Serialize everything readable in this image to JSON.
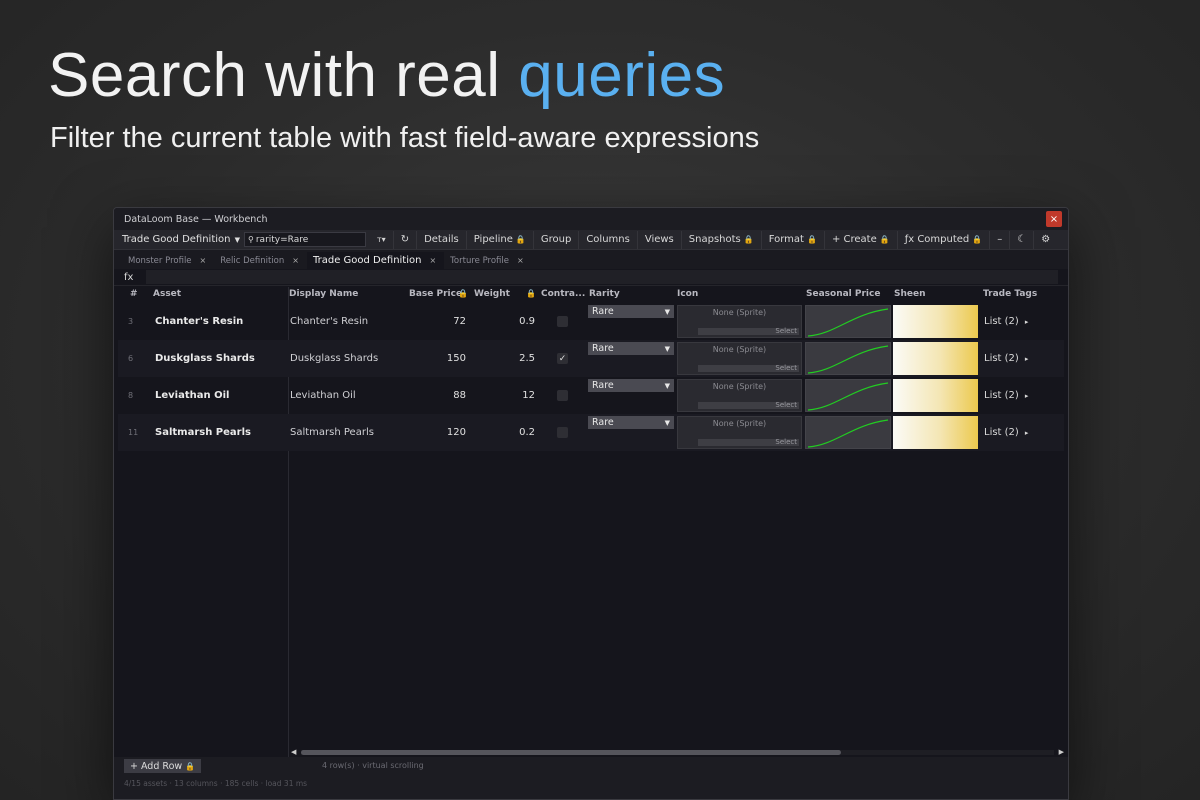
{
  "hero": {
    "title_main": "Search with real ",
    "title_accent": "queries",
    "subtitle": "Filter the current table with fast field-aware expressions"
  },
  "window": {
    "title": "DataLoom Base — Workbench",
    "close": "×"
  },
  "toolbar": {
    "table_select": "Trade Good Definition",
    "search_value": "rarity=Rare",
    "search_icon": "⚲",
    "filter_label": "ᴛ▾",
    "refresh_icon": "↻",
    "buttons": [
      "Details",
      "Pipeline",
      "Group",
      "Columns",
      "Views",
      "Snapshots",
      "Format",
      "+ Create",
      "ƒx Computed",
      "–",
      "☾",
      "⚙"
    ],
    "locked": [
      false,
      true,
      false,
      false,
      false,
      true,
      true,
      true,
      true,
      false,
      false,
      false
    ]
  },
  "tabs": [
    {
      "label": "Monster Profile",
      "active": false
    },
    {
      "label": "Relic Definition",
      "active": false
    },
    {
      "label": "Trade Good Definition",
      "active": true
    },
    {
      "label": "Torture Profile",
      "active": false
    }
  ],
  "fx_label": "fx",
  "columns": [
    "#",
    "Asset",
    "Display Name",
    "Base Price",
    "Weight",
    "Contra...",
    "Rarity",
    "Icon",
    "Seasonal Price",
    "Sheen",
    "Trade Tags"
  ],
  "rows": [
    {
      "num": "3",
      "asset": "Chanter's Resin",
      "display": "Chanter's Resin",
      "price": "72",
      "weight": "0.9",
      "contraband": false,
      "rarity": "Rare",
      "icon": "None (Sprite)",
      "icon_btn": "Select",
      "tags": "List (2)"
    },
    {
      "num": "6",
      "asset": "Duskglass Shards",
      "display": "Duskglass Shards",
      "price": "150",
      "weight": "2.5",
      "contraband": true,
      "rarity": "Rare",
      "icon": "None (Sprite)",
      "icon_btn": "Select",
      "tags": "List (2)"
    },
    {
      "num": "8",
      "asset": "Leviathan Oil",
      "display": "Leviathan Oil",
      "price": "88",
      "weight": "12",
      "contraband": false,
      "rarity": "Rare",
      "icon": "None (Sprite)",
      "icon_btn": "Select",
      "tags": "List (2)"
    },
    {
      "num": "11",
      "asset": "Saltmarsh Pearls",
      "display": "Saltmarsh Pearls",
      "price": "120",
      "weight": "0.2",
      "contraband": false,
      "rarity": "Rare",
      "icon": "None (Sprite)",
      "icon_btn": "Select",
      "tags": "List (2)"
    }
  ],
  "footer": {
    "add_row": "+ Add Row",
    "status": "4 row(s) · virtual scrolling",
    "stats": "4/15 assets · 13 columns · 185 cells · load 31 ms"
  },
  "colors": {
    "accent": "#5ab0f0",
    "lock": "#e0b030",
    "curve": "#22cc22",
    "close": "#c0392b"
  }
}
